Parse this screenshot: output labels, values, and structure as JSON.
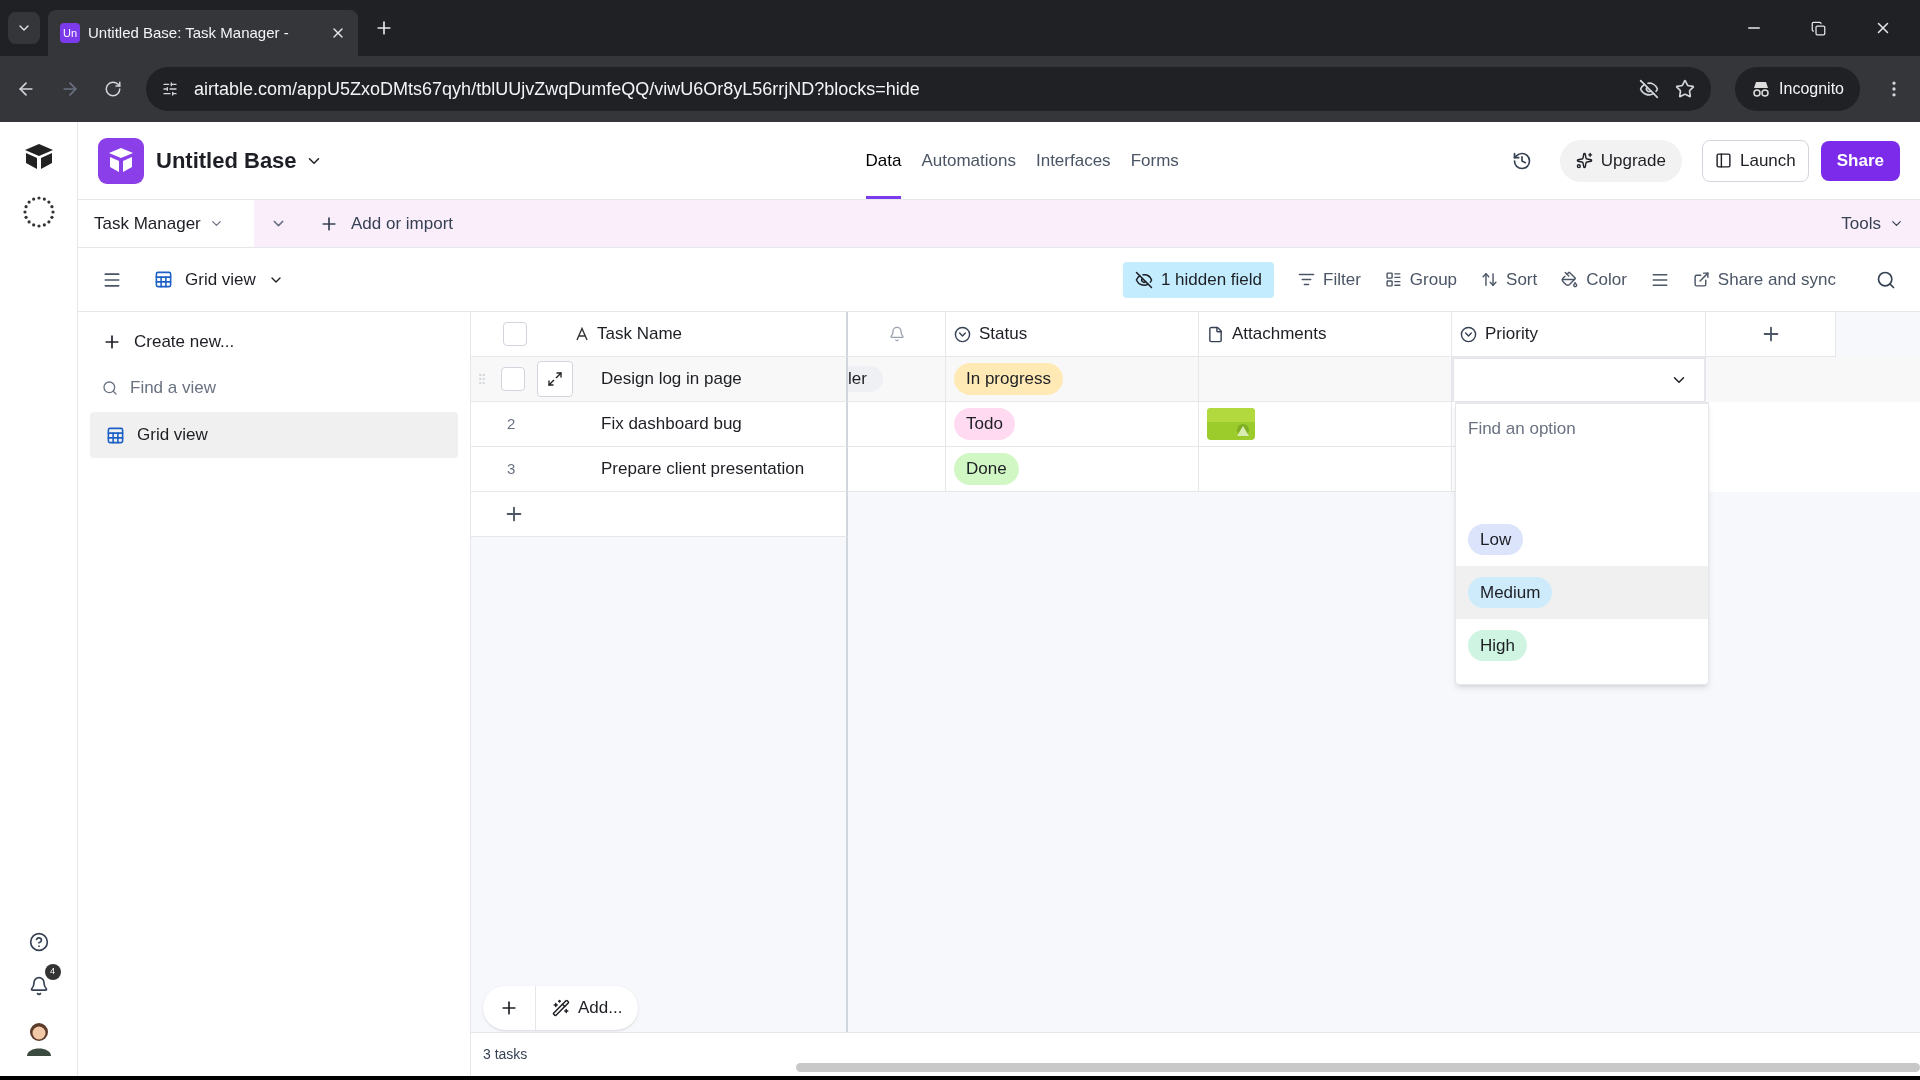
{
  "browser": {
    "tabs": [
      {
        "favicon": "Un",
        "title": "Untitled Base: Task Manager -",
        "selected": true
      }
    ],
    "url": "airtable.com/appU5ZxoDMts67qyh/tblUUjvZwqDumfeQQ/viwU6Or8yL56rrjND?blocks=hide",
    "incognito": "Incognito"
  },
  "rail": {
    "notifications": "4"
  },
  "app": {
    "base_name": "Untitled Base",
    "nav_tabs": [
      {
        "label": "Data",
        "selected": true
      },
      {
        "label": "Automations",
        "selected": false
      },
      {
        "label": "Interfaces",
        "selected": false
      },
      {
        "label": "Forms",
        "selected": false
      }
    ],
    "upgrade": "Upgrade",
    "launch": "Launch",
    "share": "Share"
  },
  "table_bar": {
    "table": "Task Manager",
    "add": "Add or import",
    "tools": "Tools"
  },
  "view_bar": {
    "view": "Grid view",
    "hidden_fields": "1 hidden field",
    "actions": [
      {
        "kind": "filter",
        "label": "Filter"
      },
      {
        "kind": "group",
        "label": "Group"
      },
      {
        "kind": "sort",
        "label": "Sort"
      },
      {
        "kind": "color",
        "label": "Color"
      },
      {
        "kind": "height"
      },
      {
        "kind": "share",
        "label": "Share and sync"
      }
    ]
  },
  "sidebar": {
    "create": "Create new...",
    "search_placeholder": "Find a view",
    "views": [
      {
        "label": "Grid view",
        "selected": true
      }
    ]
  },
  "grid": {
    "select_all_checked": false,
    "columns": [
      {
        "kind": "text",
        "label": "Task Name"
      },
      {
        "kind": "bell"
      },
      {
        "kind": "select",
        "label": "Status"
      },
      {
        "kind": "file",
        "label": "Attachments"
      },
      {
        "kind": "select",
        "label": "Priority"
      }
    ],
    "rows": [
      {
        "hovered": true,
        "checked": false,
        "task": "Design log in page",
        "column_2": "ler",
        "status": {
          "label": "In progress",
          "color": "#ffeab6"
        },
        "has_attachment": false,
        "editing": true
      },
      {
        "hovered": false,
        "number": "2",
        "task": "Fix dashboard bug",
        "status": {
          "label": "Todo",
          "color": "#ffdaf0"
        },
        "has_attachment": true,
        "editing": false
      },
      {
        "hovered": false,
        "number": "3",
        "task": "Prepare client presentation",
        "status": {
          "label": "Done",
          "color": "#d1f7c4"
        },
        "has_attachment": false,
        "editing": false
      }
    ],
    "dropdown": {
      "placeholder": "Find an option",
      "options": [
        {
          "label": "Low",
          "color": "#dbe4fb",
          "highlighted": false
        },
        {
          "label": "Medium",
          "color": "#cdebfa",
          "highlighted": true
        },
        {
          "label": "High",
          "color": "#cff5e2",
          "highlighted": false
        }
      ]
    }
  },
  "footer": {
    "add": "Add...",
    "count": "3 tasks"
  }
}
